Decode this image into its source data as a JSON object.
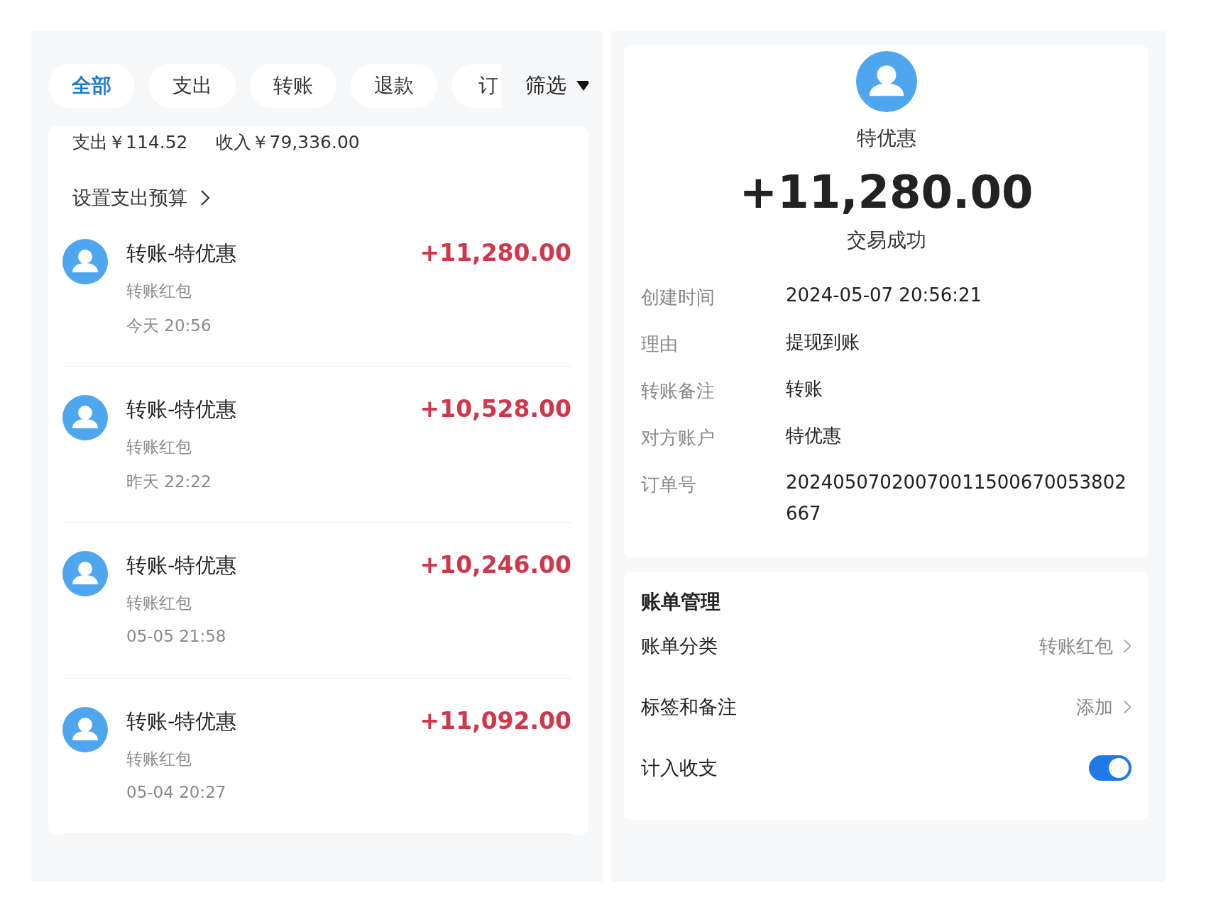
{
  "left": {
    "tabs": [
      {
        "label": "全部",
        "selected": true
      },
      {
        "label": "支出",
        "selected": false
      },
      {
        "label": "转账",
        "selected": false
      },
      {
        "label": "退款",
        "selected": false
      },
      {
        "label": "订",
        "selected": false
      }
    ],
    "filter": {
      "label": "筛选"
    },
    "summary": {
      "expense": "支出￥114.52",
      "income": "收入￥79,336.00",
      "budget_link": "设置支出预算"
    },
    "transactions": [
      {
        "title": "转账-特优惠",
        "category": "转账红包",
        "time": "今天 20:56",
        "amount": "+11,280.00"
      },
      {
        "title": "转账-特优惠",
        "category": "转账红包",
        "time": "昨天 22:22",
        "amount": "+10,528.00"
      },
      {
        "title": "转账-特优惠",
        "category": "转账红包",
        "time": "05-05 21:58",
        "amount": "+10,246.00"
      },
      {
        "title": "转账-特优惠",
        "category": "转账红包",
        "time": "05-04 20:27",
        "amount": "+11,092.00"
      }
    ]
  },
  "right": {
    "name": "特优惠",
    "amount": "+11,280.00",
    "status": "交易成功",
    "details": [
      {
        "label": "创建时间",
        "value": "2024-05-07 20:56:21"
      },
      {
        "label": "理由",
        "value": "提现到账"
      },
      {
        "label": "转账备注",
        "value": "转账"
      },
      {
        "label": "对方账户",
        "value": "特优惠"
      },
      {
        "label": "订单号",
        "value": "20240507020070011500670053802667"
      }
    ],
    "management": {
      "title": "账单管理",
      "rows": [
        {
          "kind": "link",
          "label": "账单分类",
          "value": "转账红包"
        },
        {
          "kind": "link",
          "label": "标签和备注",
          "value": "添加"
        },
        {
          "kind": "toggle",
          "label": "计入收支",
          "on": true
        }
      ]
    }
  }
}
